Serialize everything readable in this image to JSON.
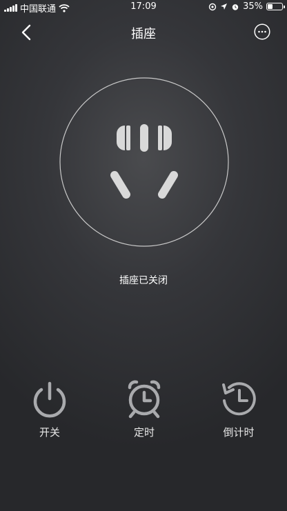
{
  "status_bar": {
    "carrier": "中国联通",
    "time": "17:09",
    "battery_percent": "35%",
    "battery_level": 0.35,
    "icons": [
      "signal-icon",
      "wifi-icon",
      "location-lock-icon",
      "location-arrow-icon",
      "alarm-icon",
      "battery-icon"
    ]
  },
  "nav": {
    "title": "插座",
    "back_icon": "chevron-left-icon",
    "more_icon": "more-icon"
  },
  "device": {
    "icon": "plug-socket-icon",
    "status_text": "插座已关闭"
  },
  "actions": [
    {
      "label": "开关",
      "icon": "power-icon"
    },
    {
      "label": "定时",
      "icon": "alarm-clock-icon"
    },
    {
      "label": "倒计时",
      "icon": "countdown-icon"
    }
  ],
  "colors": {
    "icon_gray": "#a9aaad",
    "ring": "#c9c9c9",
    "background": "#35363a"
  }
}
